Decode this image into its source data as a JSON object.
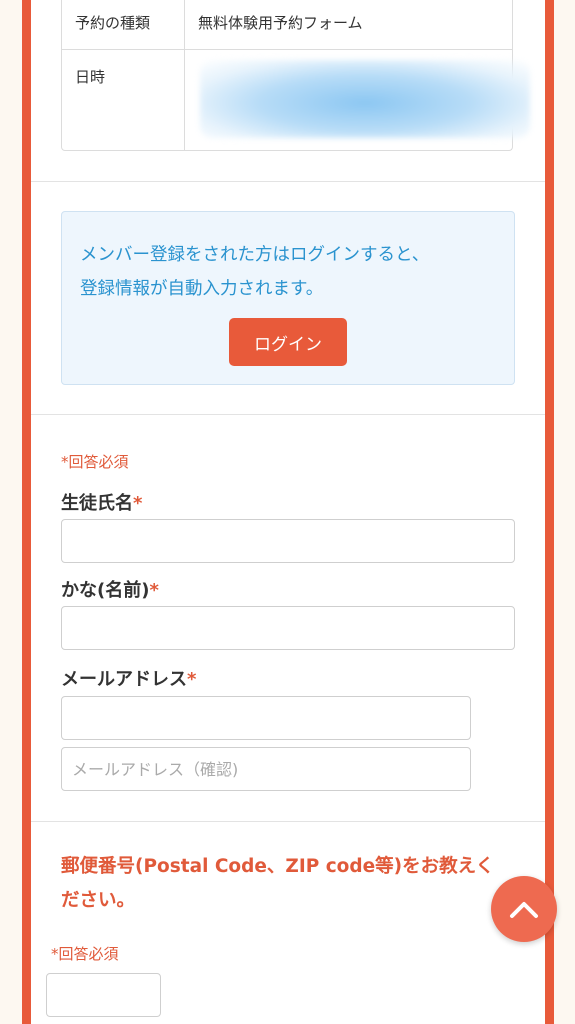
{
  "summary": {
    "rows": [
      {
        "label": "予約の種類",
        "value": "無料体験用予約フォーム"
      },
      {
        "label": "日時",
        "value": ""
      }
    ]
  },
  "login_notice": {
    "line1": "メンバー登録をされた方はログインすると、",
    "line2": "登録情報が自動入力されます。",
    "button": "ログイン"
  },
  "form": {
    "required_note": "*回答必須",
    "student_name_label": "生徒氏名",
    "kana_label": "かな(名前)",
    "email_label": "メールアドレス",
    "email_confirm_placeholder": "メールアドレス（確認)",
    "required_star": "*"
  },
  "postal": {
    "title_line1": "郵便番号(Postal Code、ZIP code等)をお教えく",
    "title_line2": "ださい。",
    "required_note": "*回答必須"
  },
  "colors": {
    "accent": "#e85a3a",
    "link_blue": "#2a93cf",
    "notice_bg": "#eef6fd"
  },
  "icons": {
    "scroll_top": "chevron-up-icon"
  }
}
